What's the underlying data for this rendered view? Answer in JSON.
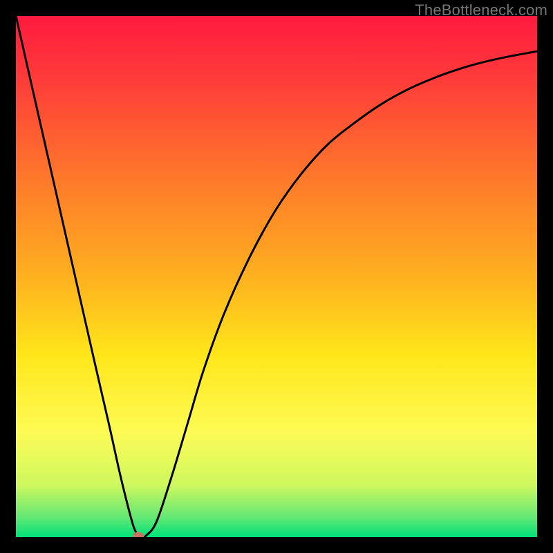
{
  "watermark": "TheBottleneck.com",
  "chart_data": {
    "type": "line",
    "title": "",
    "xlabel": "",
    "ylabel": "",
    "xlim": [
      0,
      100
    ],
    "ylim": [
      0,
      100
    ],
    "grid": false,
    "legend": false,
    "background_gradient": {
      "type": "vertical",
      "stops": [
        {
          "pct": 0,
          "color": "#ff1a3f"
        },
        {
          "pct": 12,
          "color": "#ff3b3a"
        },
        {
          "pct": 32,
          "color": "#ff7b2a"
        },
        {
          "pct": 50,
          "color": "#ffb01f"
        },
        {
          "pct": 65,
          "color": "#ffe61a"
        },
        {
          "pct": 80,
          "color": "#fdfb55"
        },
        {
          "pct": 90,
          "color": "#cef85f"
        },
        {
          "pct": 96,
          "color": "#67e873"
        },
        {
          "pct": 100,
          "color": "#00e27a"
        }
      ]
    },
    "series": [
      {
        "name": "curve",
        "color": "#000000",
        "x": [
          0,
          5,
          10,
          15,
          18,
          20,
          22,
          23,
          24,
          25,
          27,
          30,
          33,
          36,
          40,
          45,
          50,
          55,
          60,
          65,
          70,
          75,
          80,
          85,
          90,
          95,
          100
        ],
        "y": [
          100,
          78,
          56,
          34,
          21,
          12,
          4,
          1,
          0,
          0.3,
          3,
          12,
          22,
          32,
          43,
          54,
          63,
          70,
          75.5,
          79.5,
          83,
          85.8,
          88,
          89.8,
          91.2,
          92.3,
          93.2
        ]
      }
    ],
    "marker": {
      "name": "minimum-point",
      "x": 23.5,
      "y": 0.2,
      "color": "#c97463",
      "rx": 8,
      "ry": 6
    }
  }
}
